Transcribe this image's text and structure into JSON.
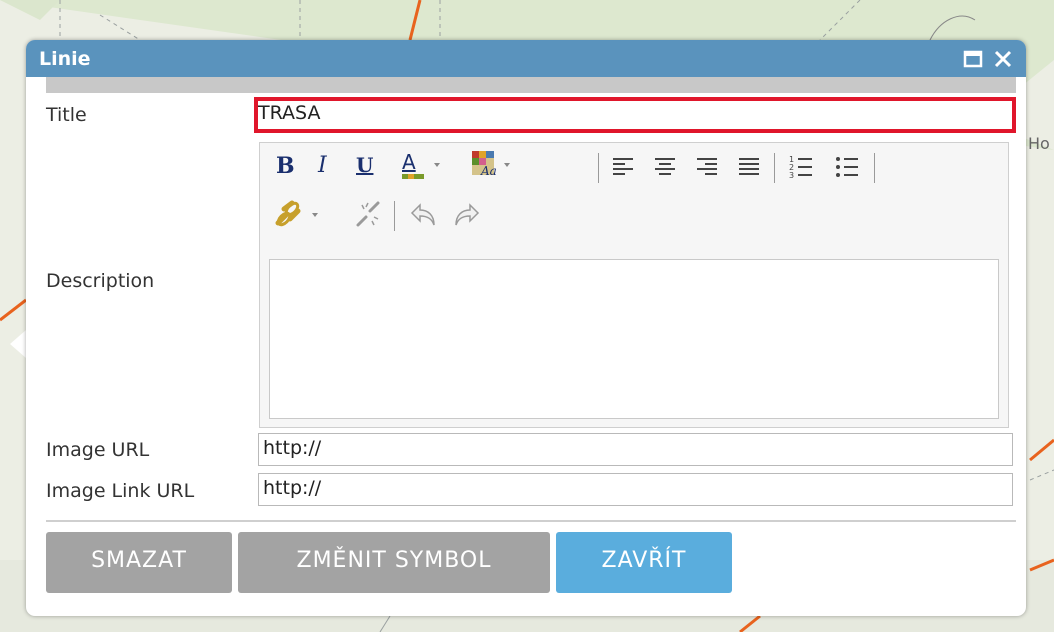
{
  "dialog": {
    "title": "Linie",
    "maximize_icon": "maximize-icon",
    "close_icon": "close-icon"
  },
  "form": {
    "title_label": "Title",
    "title_value": "TRASA",
    "description_label": "Description",
    "image_url_label": "Image URL",
    "image_url_value": "http://",
    "image_link_url_label": "Image Link URL",
    "image_link_url_value": "http://"
  },
  "toolbar": {
    "bold": "B",
    "italic": "I",
    "underline": "U",
    "font_color": "A",
    "icons": [
      "bold-icon",
      "italic-icon",
      "underline-icon",
      "font-color-icon",
      "highlight-color-icon",
      "align-left-icon",
      "align-center-icon",
      "align-right-icon",
      "justify-icon",
      "numbered-list-icon",
      "bulleted-list-icon",
      "link-icon",
      "unlink-icon",
      "undo-icon",
      "redo-icon"
    ]
  },
  "buttons": {
    "delete": "SMAZAT",
    "change_symbol": "ZMĚNIT SYMBOL",
    "close": "ZAVŘÍT"
  },
  "map": {
    "label_fragment": "Ho"
  },
  "colors": {
    "titlebar": "#5a93bd",
    "highlight_border": "#e0162b",
    "primary_button": "#5aaddd",
    "secondary_button": "#a3a3a3",
    "map_route": "#e8631e"
  }
}
